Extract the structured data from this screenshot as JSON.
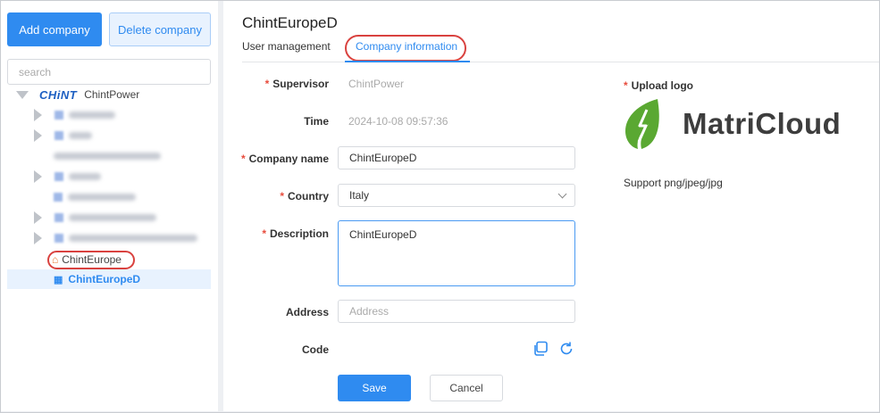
{
  "sidebar": {
    "add_label": "Add company",
    "delete_label": "Delete company",
    "search_placeholder": "search",
    "root": {
      "brand": "CHiNT",
      "label": "ChintPower"
    },
    "items": [
      {
        "label": "ChintEurope"
      },
      {
        "label": "ChintEuropeD"
      }
    ]
  },
  "header": {
    "title": "ChintEuropeD",
    "tabs": [
      {
        "label": "User management"
      },
      {
        "label": "Company information"
      }
    ]
  },
  "form": {
    "supervisor": {
      "label": "Supervisor",
      "value": "ChintPower"
    },
    "time": {
      "label": "Time",
      "value": "2024-10-08  09:57:36"
    },
    "company_name": {
      "label": "Company name",
      "value": "ChintEuropeD"
    },
    "country": {
      "label": "Country",
      "value": "Italy"
    },
    "description": {
      "label": "Description",
      "value": "ChintEuropeD"
    },
    "address": {
      "label": "Address",
      "placeholder": "Address"
    },
    "code": {
      "label": "Code"
    },
    "required_mark": "*",
    "save_label": "Save",
    "cancel_label": "Cancel"
  },
  "upload": {
    "label": "Upload logo",
    "logo_text": "MatriCloud",
    "hint": "Support png/jpeg/jpg"
  },
  "colors": {
    "accent": "#2f8bf0",
    "annotation_ring": "#d9423f",
    "required": "#e84c3d",
    "logo_green": "#5aa832"
  }
}
